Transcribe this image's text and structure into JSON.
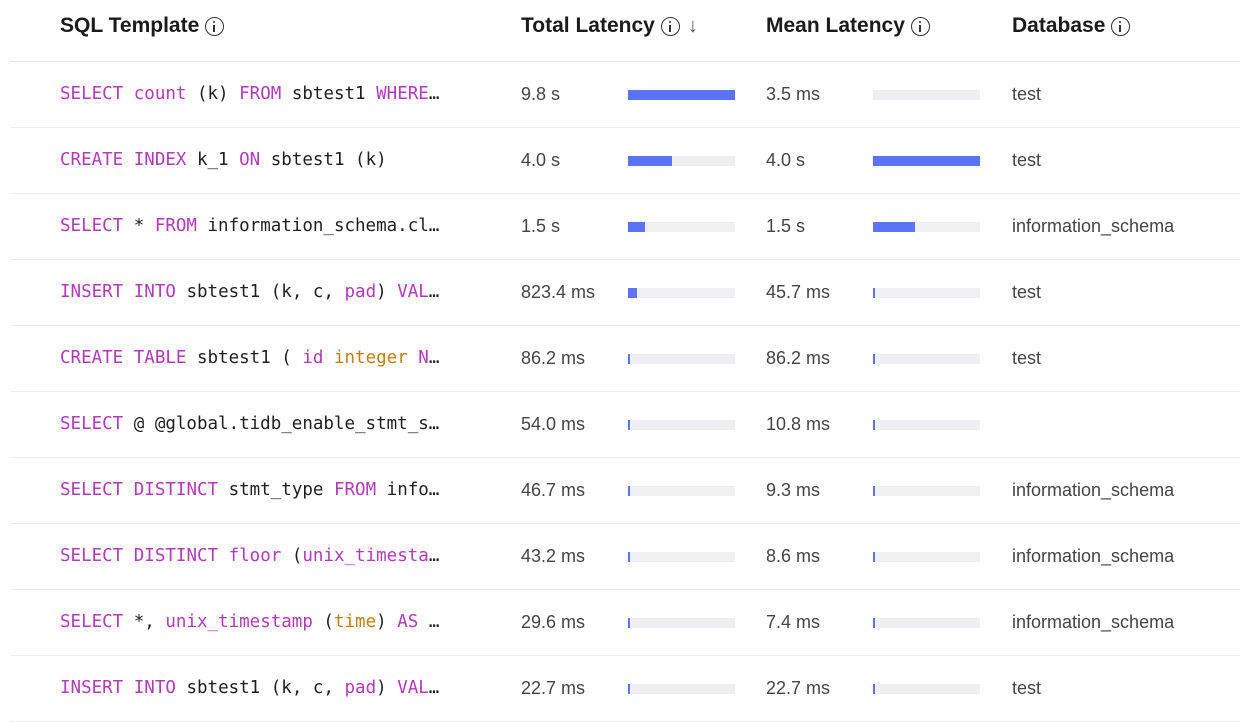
{
  "headers": {
    "sql_template": "SQL Template",
    "total_latency": "Total Latency",
    "mean_latency": "Mean Latency",
    "database": "Database"
  },
  "colors": {
    "bar": "#5b73f5",
    "track": "#f0f0f2",
    "keyword": "#b03ab8",
    "type": "#c07d12"
  },
  "rows": [
    {
      "sql_tokens": [
        [
          "k",
          "SELECT"
        ],
        [
          "t",
          " "
        ],
        [
          "k",
          "count"
        ],
        [
          "t",
          " (k) "
        ],
        [
          "k",
          "FROM"
        ],
        [
          "t",
          " sbtest1 "
        ],
        [
          "k",
          "WHERE"
        ],
        [
          "t",
          "…"
        ]
      ],
      "total": "9.8 s",
      "total_fraction": 1.0,
      "mean": "3.5 ms",
      "mean_fraction": 0.0,
      "database": "test"
    },
    {
      "sql_tokens": [
        [
          "k",
          "CREATE"
        ],
        [
          "t",
          " "
        ],
        [
          "k",
          "INDEX"
        ],
        [
          "t",
          " k_1 "
        ],
        [
          "k",
          "ON"
        ],
        [
          "t",
          " sbtest1 (k)"
        ]
      ],
      "total": "4.0 s",
      "total_fraction": 0.41,
      "mean": "4.0 s",
      "mean_fraction": 1.0,
      "database": "test"
    },
    {
      "sql_tokens": [
        [
          "k",
          "SELECT"
        ],
        [
          "t",
          " * "
        ],
        [
          "k",
          "FROM"
        ],
        [
          "t",
          " information_schema.cl…"
        ]
      ],
      "total": "1.5 s",
      "total_fraction": 0.155,
      "mean": "1.5 s",
      "mean_fraction": 0.39,
      "database": "information_schema"
    },
    {
      "sql_tokens": [
        [
          "k",
          "INSERT"
        ],
        [
          "t",
          " "
        ],
        [
          "k",
          "INTO"
        ],
        [
          "t",
          " sbtest1 (k, c, "
        ],
        [
          "k",
          "pad"
        ],
        [
          "t",
          ") "
        ],
        [
          "k",
          "VAL"
        ],
        [
          "t",
          "…"
        ]
      ],
      "total": "823.4 ms",
      "total_fraction": 0.084,
      "mean": "45.7 ms",
      "mean_fraction": 0.012,
      "database": "test"
    },
    {
      "sql_tokens": [
        [
          "k",
          "CREATE"
        ],
        [
          "t",
          " "
        ],
        [
          "k",
          "TABLE"
        ],
        [
          "t",
          " sbtest1 ( "
        ],
        [
          "k",
          "id"
        ],
        [
          "t",
          " "
        ],
        [
          "f",
          "integer"
        ],
        [
          "t",
          " "
        ],
        [
          "k",
          "N"
        ],
        [
          "t",
          "…"
        ]
      ],
      "total": "86.2 ms",
      "total_fraction": 0.009,
      "mean": "86.2 ms",
      "mean_fraction": 0.022,
      "database": "test"
    },
    {
      "sql_tokens": [
        [
          "k",
          "SELECT"
        ],
        [
          "t",
          " @ @global.tidb_enable_stmt_s…"
        ]
      ],
      "total": "54.0 ms",
      "total_fraction": 0.006,
      "mean": "10.8 ms",
      "mean_fraction": 0.003,
      "database": ""
    },
    {
      "sql_tokens": [
        [
          "k",
          "SELECT"
        ],
        [
          "t",
          " "
        ],
        [
          "k",
          "DISTINCT"
        ],
        [
          "t",
          " stmt_type "
        ],
        [
          "k",
          "FROM"
        ],
        [
          "t",
          " info…"
        ]
      ],
      "total": "46.7 ms",
      "total_fraction": 0.005,
      "mean": "9.3 ms",
      "mean_fraction": 0.002,
      "database": "information_schema"
    },
    {
      "sql_tokens": [
        [
          "k",
          "SELECT"
        ],
        [
          "t",
          " "
        ],
        [
          "k",
          "DISTINCT"
        ],
        [
          "t",
          " "
        ],
        [
          "k",
          "floor"
        ],
        [
          "t",
          " ("
        ],
        [
          "k",
          "unix_timesta"
        ],
        [
          "t",
          "…"
        ]
      ],
      "total": "43.2 ms",
      "total_fraction": 0.004,
      "mean": "8.6 ms",
      "mean_fraction": 0.002,
      "database": "information_schema"
    },
    {
      "sql_tokens": [
        [
          "k",
          "SELECT"
        ],
        [
          "t",
          " *, "
        ],
        [
          "k",
          "unix_timestamp"
        ],
        [
          "t",
          " ("
        ],
        [
          "f",
          "time"
        ],
        [
          "t",
          ") "
        ],
        [
          "k",
          "AS"
        ],
        [
          "t",
          " …"
        ]
      ],
      "total": "29.6 ms",
      "total_fraction": 0.003,
      "mean": "7.4 ms",
      "mean_fraction": 0.002,
      "database": "information_schema"
    },
    {
      "sql_tokens": [
        [
          "k",
          "INSERT"
        ],
        [
          "t",
          " "
        ],
        [
          "k",
          "INTO"
        ],
        [
          "t",
          " sbtest1 (k, c, "
        ],
        [
          "k",
          "pad"
        ],
        [
          "t",
          ") "
        ],
        [
          "k",
          "VAL"
        ],
        [
          "t",
          "…"
        ]
      ],
      "total": "22.7 ms",
      "total_fraction": 0.002,
      "mean": "22.7 ms",
      "mean_fraction": 0.006,
      "database": "test"
    }
  ]
}
